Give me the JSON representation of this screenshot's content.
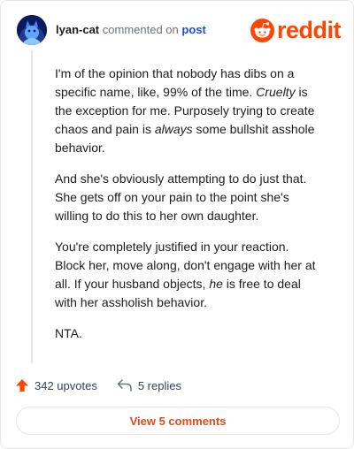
{
  "header": {
    "username": "lyan-cat",
    "action_text": "commented on",
    "post_link": "post",
    "logo_text": "reddit"
  },
  "comment": {
    "p1_part1": "I'm of the opinion that nobody has dibs on a specific name, like, 99% of the time. ",
    "p1_em1": "Cruelty",
    "p1_part2": " is the exception for me. Purposely trying to create chaos and pain is ",
    "p1_em2": "always",
    "p1_part3": " some bullshit asshole behavior.",
    "p2": "And she's obviously attempting to do just that. She gets off on your pain to the point she's willing to do this to her own daughter.",
    "p3_part1": "You're completely justified in your reaction. Block her, move along, don't engage with her at all. If your husband objects, ",
    "p3_em": "he",
    "p3_part2": " is free to deal with her assholish behavior.",
    "p4": "NTA."
  },
  "actions": {
    "upvotes": "342 upvotes",
    "replies": "5 replies"
  },
  "view_comments_label": "View 5 comments",
  "colors": {
    "brand": "#ff4500",
    "link": "#1d4ed8",
    "button_text": "#e04a1b"
  }
}
